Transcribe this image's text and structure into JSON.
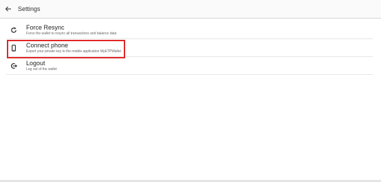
{
  "header": {
    "title": "Settings",
    "back_icon": "arrow-left-icon"
  },
  "items": [
    {
      "title": "Force Resync",
      "description": "Force the wallet to resync all transactions and balance data",
      "icon": "refresh-icon"
    },
    {
      "title": "Connect phone",
      "description": "Export your private key to the mobile application MyETPWallet",
      "icon": "phone-icon"
    },
    {
      "title": "Logout",
      "description": "Log out of the wallet",
      "icon": "logout-icon"
    }
  ],
  "colors": {
    "highlight": "#e02424",
    "divider": "#e6e6e6"
  }
}
